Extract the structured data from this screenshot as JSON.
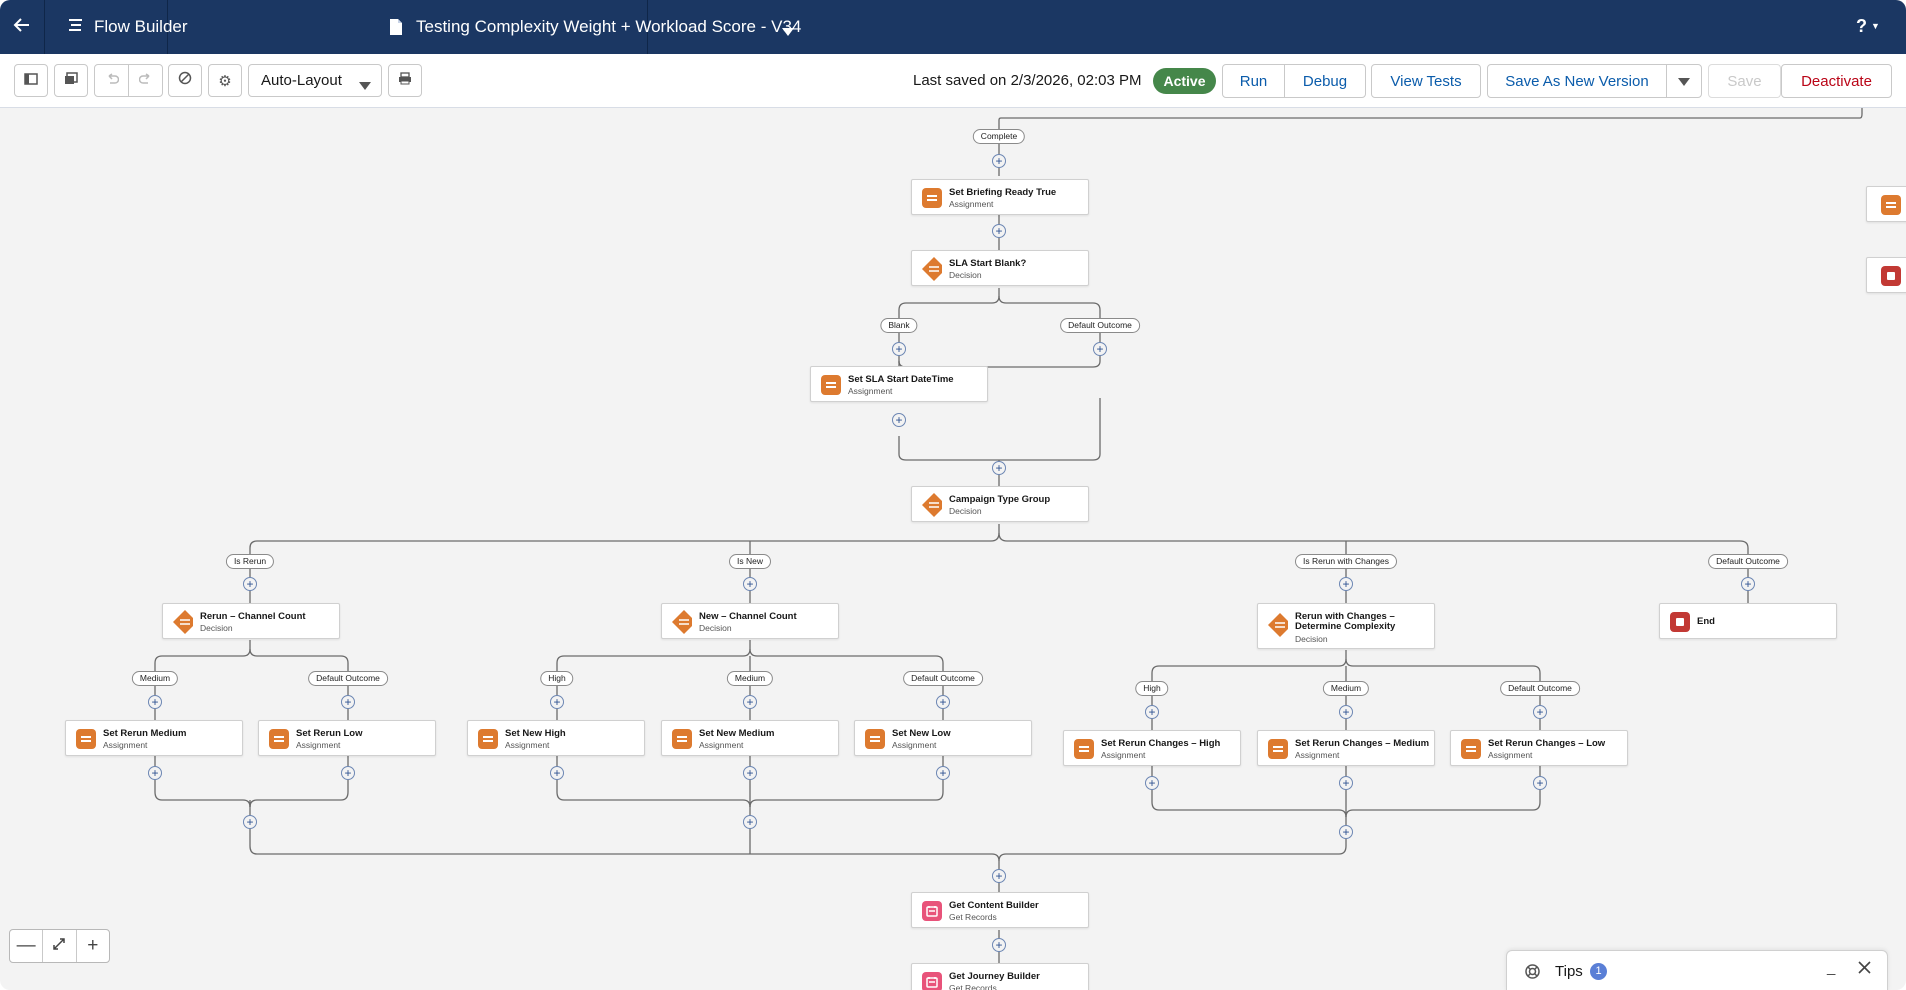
{
  "header": {
    "back_icon": "arrow-left-icon",
    "app_icon": "flow-icon",
    "app_title": "Flow Builder",
    "doc_icon": "document-icon",
    "flow_title": "Testing Complexity Weight + Workload Score - V34",
    "help_label": "?"
  },
  "toolbar": {
    "layout_value": "Auto-Layout",
    "last_saved": "Last saved on 2/3/2026, 02:03 PM",
    "status": "Active",
    "run": "Run",
    "debug": "Debug",
    "view_tests": "View Tests",
    "save_as_new": "Save As New Version",
    "save": "Save",
    "deactivate": "Deactivate"
  },
  "colors": {
    "header": "#1b3763",
    "assignment": "#dd7a2f",
    "decision": "#dd7a2f",
    "get_records": "#e8537a",
    "end": "#c23934",
    "active": "#45874a",
    "deactivate": "#ba0517"
  },
  "labels": {
    "complete": "Complete",
    "blank": "Blank",
    "default1": "Default Outcome",
    "is_rerun": "Is Rerun",
    "is_new": "Is New",
    "is_rerun_changes": "Is Rerun with Changes",
    "default2": "Default Outcome",
    "medium1": "Medium",
    "default3": "Default Outcome",
    "high1": "High",
    "medium2": "Medium",
    "default4": "Default Outcome",
    "high2": "High",
    "medium3": "Medium",
    "default5": "Default Outcome"
  },
  "nodes": {
    "briefing": {
      "name": "Set Briefing Ready True",
      "type": "Assignment"
    },
    "sla_blank": {
      "name": "SLA Start Blank?",
      "type": "Decision"
    },
    "sla_set": {
      "name": "Set SLA Start DateTime",
      "type": "Assignment"
    },
    "campaign": {
      "name": "Campaign Type Group",
      "type": "Decision"
    },
    "rerun_count": {
      "name": "Rerun – Channel Count",
      "type": "Decision"
    },
    "new_count": {
      "name": "New – Channel Count",
      "type": "Decision"
    },
    "rerun_changes": {
      "name": "Rerun with Changes –",
      "name2": "Determine Complexity",
      "type": "Decision"
    },
    "end": {
      "name": "End"
    },
    "rerun_medium": {
      "name": "Set Rerun Medium",
      "type": "Assignment"
    },
    "rerun_low": {
      "name": "Set Rerun Low",
      "type": "Assignment"
    },
    "new_high": {
      "name": "Set New High",
      "type": "Assignment"
    },
    "new_medium": {
      "name": "Set New Medium",
      "type": "Assignment"
    },
    "new_low": {
      "name": "Set New Low",
      "type": "Assignment"
    },
    "rc_high": {
      "name": "Set Rerun Changes – High",
      "type": "Assignment"
    },
    "rc_medium": {
      "name": "Set Rerun Changes – Medium",
      "type": "Assignment"
    },
    "rc_low": {
      "name": "Set Rerun Changes – Low",
      "type": "Assignment"
    },
    "content_builder": {
      "name": "Get Content Builder",
      "type": "Get Records"
    },
    "journey_builder": {
      "name": "Get Journey Builder",
      "type": "Get Records"
    }
  },
  "tips": {
    "label": "Tips",
    "count": "1"
  }
}
